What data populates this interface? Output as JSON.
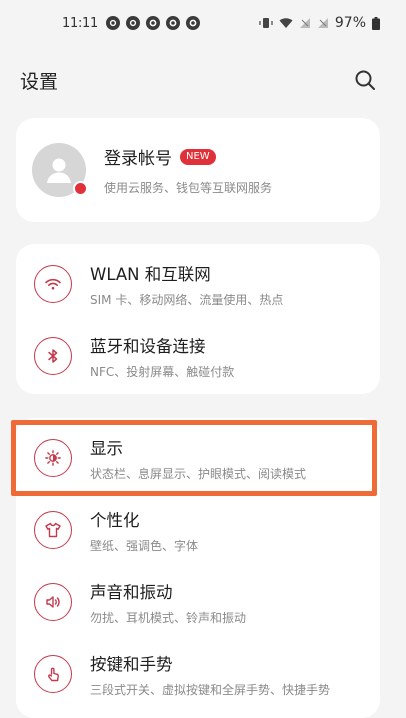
{
  "status_bar": {
    "time": "11:11",
    "battery": "97%",
    "notification_icons": [
      "notification-icon",
      "notification-icon",
      "notification-icon",
      "notification-icon",
      "notification-icon"
    ]
  },
  "header": {
    "title": "设置",
    "search_icon": "search-icon"
  },
  "account": {
    "title": "登录帐号",
    "badge": "NEW",
    "subtitle": "使用云服务、钱包等互联网服务"
  },
  "settings_groups": [
    {
      "items": [
        {
          "title": "WLAN 和互联网",
          "subtitle": "SIM 卡、移动网络、流量使用、热点",
          "icon": "wifi-icon"
        },
        {
          "title": "蓝牙和设备连接",
          "subtitle": "NFC、投射屏幕、触碰付款",
          "icon": "bluetooth-icon"
        }
      ]
    },
    {
      "items": [
        {
          "title": "显示",
          "subtitle": "状态栏、息屏显示、护眼模式、阅读模式",
          "icon": "brightness-icon",
          "highlighted": true
        },
        {
          "title": "个性化",
          "subtitle": "壁纸、强调色、字体",
          "icon": "tshirt-icon"
        },
        {
          "title": "声音和振动",
          "subtitle": "勿扰、耳机模式、铃声和振动",
          "icon": "speaker-icon"
        },
        {
          "title": "按键和手势",
          "subtitle": "三段式开关、虚拟按键和全屏手势、快捷手势",
          "icon": "gesture-icon"
        }
      ]
    }
  ],
  "colors": {
    "accent": "#c43a4c",
    "highlight": "#ef6a36",
    "badge": "#e0313a"
  }
}
